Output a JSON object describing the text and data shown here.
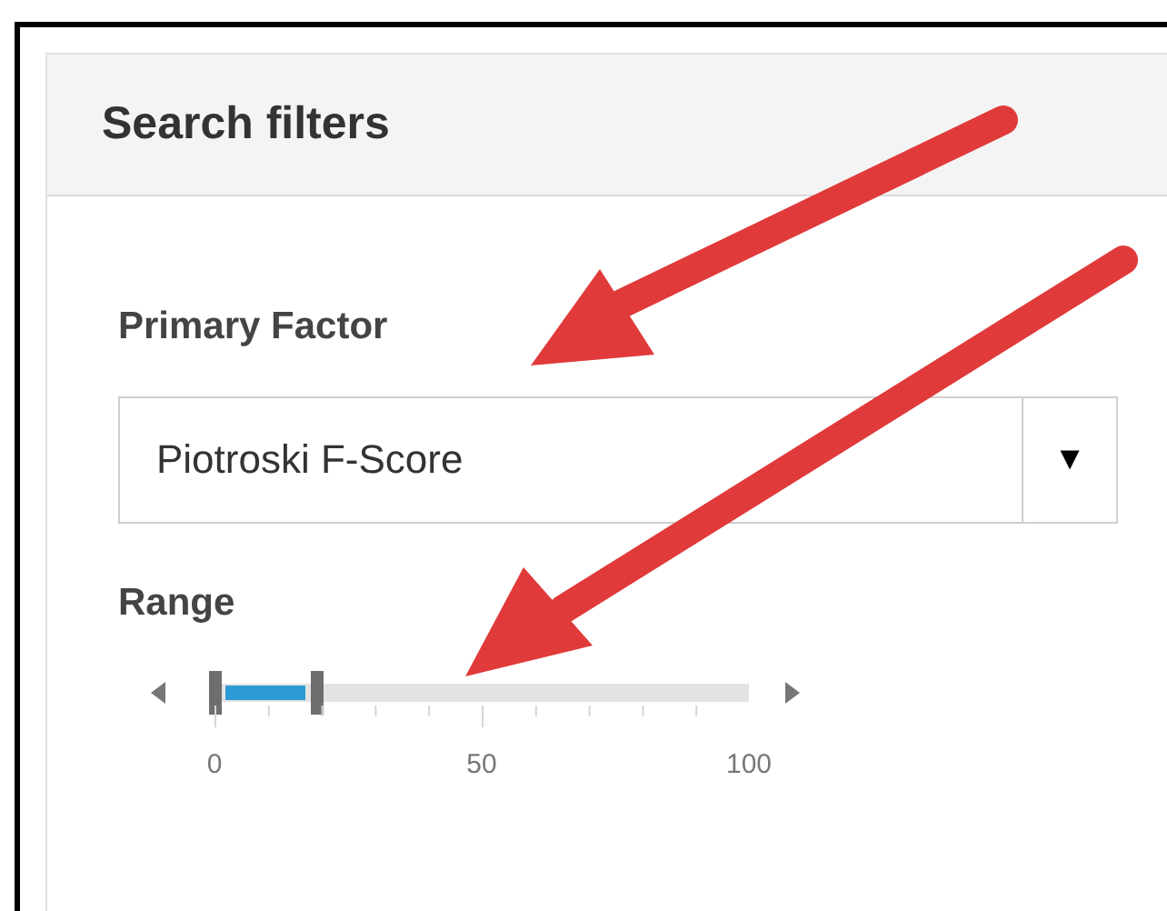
{
  "panel": {
    "title": "Search filters"
  },
  "primary_factor": {
    "label": "Primary Factor",
    "value": "Piotroski F-Score",
    "caret": "▼"
  },
  "range": {
    "label": "Range",
    "level": 0.19,
    "ticks": [
      "0",
      "50",
      "100"
    ]
  }
}
